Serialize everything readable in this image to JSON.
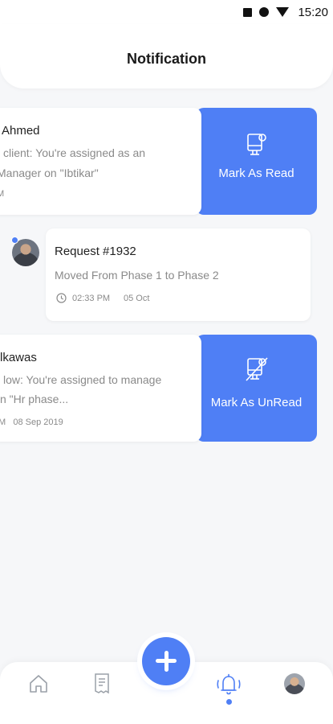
{
  "status_bar": {
    "time": "15:20"
  },
  "header": {
    "title": "Notification"
  },
  "notifications": [
    {
      "title": "Ahmed",
      "line1": "client: You're assigned as an",
      "line2": "Manager on \"Ibtikar\"",
      "meta": "M",
      "action_label": "Mark As Read",
      "action_icon": "mark-read-icon"
    },
    {
      "title": "Request #1932",
      "line1": "Moved From Phase 1 to Phase 2",
      "time": "02:33 PM",
      "date": "05 Oct"
    },
    {
      "title": "lkawas",
      "line1": "low: You're assigned to manage",
      "line2": "n \"Hr phase...",
      "meta": "M   08 Sep 2019",
      "action_label": "Mark As UnRead",
      "action_icon": "mark-unread-icon"
    }
  ],
  "bottom_nav": {
    "items": [
      {
        "icon": "home-icon"
      },
      {
        "icon": "requests-icon"
      },
      {
        "icon": "add-icon"
      },
      {
        "icon": "notification-bell-icon",
        "active": true
      },
      {
        "icon": "profile-avatar"
      }
    ]
  },
  "colors": {
    "accent": "#4f7ff5",
    "background": "#f6f7f9",
    "card": "#ffffff"
  }
}
